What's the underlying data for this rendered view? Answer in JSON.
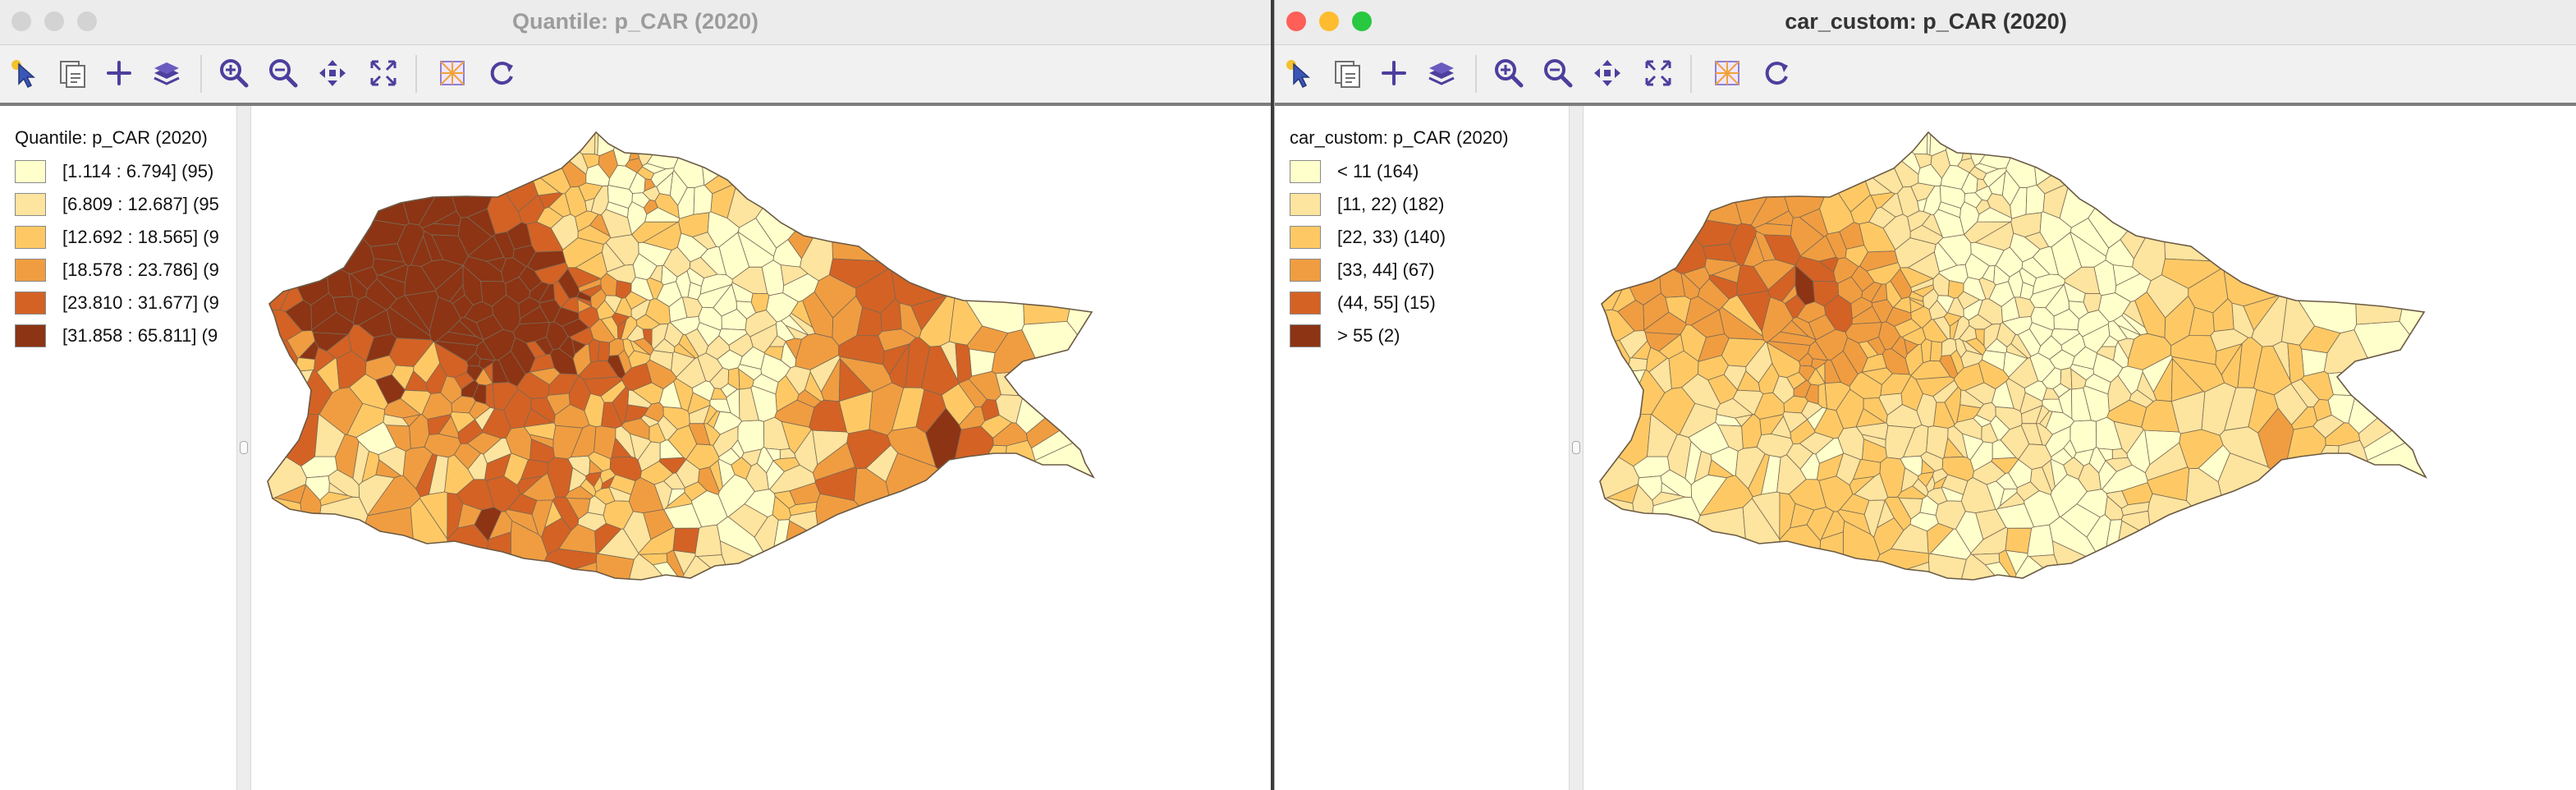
{
  "palette": [
    "#ffffcc",
    "#fde49f",
    "#fec965",
    "#f09d41",
    "#d46224",
    "#8c3414"
  ],
  "window_left": {
    "title": "Quantile: p_CAR (2020)",
    "legend": {
      "title": "Quantile: p_CAR (2020)",
      "items": [
        {
          "label": "[1.114 : 6.794] (95)",
          "color": "#ffffcc"
        },
        {
          "label": "[6.809 : 12.687] (95",
          "color": "#fde49f"
        },
        {
          "label": "[12.692 : 18.565] (9",
          "color": "#fec965"
        },
        {
          "label": "[18.578 : 23.786] (9",
          "color": "#f09d41"
        },
        {
          "label": "[23.810 : 31.677] (9",
          "color": "#d46224"
        },
        {
          "label": "[31.858 : 65.811] (9",
          "color": "#8c3414"
        }
      ]
    },
    "map_weights": [
      0.16,
      0.17,
      0.17,
      0.17,
      0.17,
      0.16
    ]
  },
  "window_right": {
    "title": "car_custom: p_CAR (2020)",
    "legend": {
      "title": "car_custom: p_CAR (2020)",
      "items": [
        {
          "label": "< 11 (164)",
          "color": "#ffffcc"
        },
        {
          "label": "[11, 22) (182)",
          "color": "#fde49f"
        },
        {
          "label": "[22, 33) (140)",
          "color": "#fec965"
        },
        {
          "label": "[33, 44] (67)",
          "color": "#f09d41"
        },
        {
          "label": "(44, 55] (15)",
          "color": "#d46224"
        },
        {
          "label": "> 55 (2)",
          "color": "#8c3414"
        }
      ]
    },
    "map_weights": [
      0.29,
      0.32,
      0.245,
      0.118,
      0.025,
      0.004
    ]
  },
  "toolbar_tools": [
    "select-pointer-icon",
    "copy-to-clipboard-icon",
    "add-icon",
    "layers-icon",
    "zoom-in-icon",
    "zoom-out-icon",
    "pan-icon",
    "fit-to-window-icon",
    "map-options-icon",
    "refresh-icon"
  ]
}
